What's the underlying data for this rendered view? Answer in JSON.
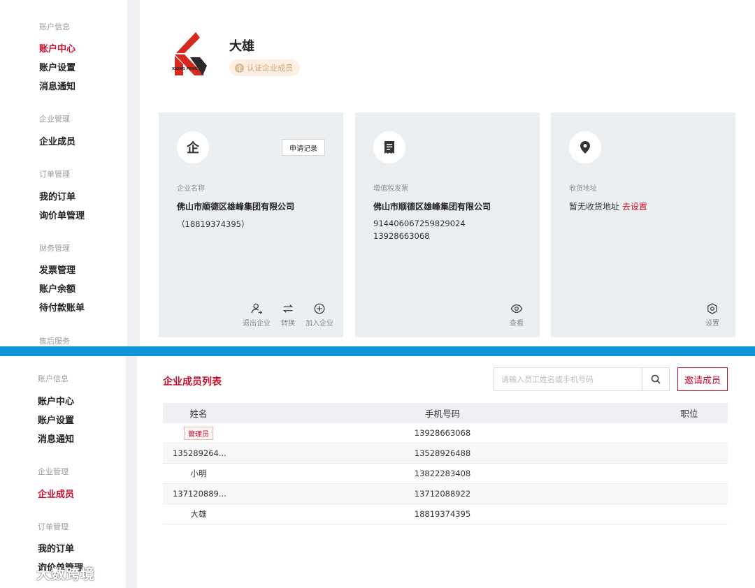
{
  "top_sidebar": {
    "sections": [
      {
        "title": "账户信息",
        "items": [
          "账户中心",
          "账户设置",
          "消息通知"
        ]
      },
      {
        "title": "企业管理",
        "items": [
          "企业成员"
        ]
      },
      {
        "title": "订单管理",
        "items": [
          "我的订单",
          "询价单管理"
        ]
      },
      {
        "title": "财务管理",
        "items": [
          "发票管理",
          "账户余额",
          "待付款账单"
        ]
      },
      {
        "title": "售后服务",
        "items": []
      }
    ],
    "active": "账户中心"
  },
  "header": {
    "logo_text": "XIONG FENG",
    "company_short": "大雄",
    "cert_badge": "认证企业成员",
    "cert_badge_icon": "企"
  },
  "cards": {
    "company": {
      "icon_char": "企",
      "apply_button": "申请记录",
      "label": "企业名称",
      "name": "佛山市顺德区雄峰集团有限公司",
      "phone": "（18819374395）",
      "actions": [
        "退出企业",
        "转换",
        "加入企业"
      ]
    },
    "invoice": {
      "label": "增值税发票",
      "name": "佛山市顺德区雄峰集团有限公司",
      "tax_id": "914406067259829024",
      "phone": "13928663068",
      "action": "查看"
    },
    "address": {
      "label": "收货地址",
      "empty_text": "暂无收货地址",
      "set_link": "去设置",
      "action": "设置"
    }
  },
  "bottom_sidebar": {
    "sections": [
      {
        "title": "账户信息",
        "items": [
          "账户中心",
          "账户设置",
          "消息通知"
        ]
      },
      {
        "title": "企业管理",
        "items": [
          "企业成员"
        ]
      },
      {
        "title": "订单管理",
        "items": [
          "我的订单",
          "询价单管理"
        ]
      }
    ],
    "active": "企业成员"
  },
  "members": {
    "title": "企业成员列表",
    "search_placeholder": "请输入员工姓名或手机号码",
    "invite_button": "邀请成员",
    "columns": [
      "姓名",
      "手机号码",
      "职位"
    ],
    "rows": [
      {
        "name": "管理员",
        "is_tag": true,
        "phone": "13928663068",
        "position": ""
      },
      {
        "name": "135289264...",
        "is_tag": false,
        "phone": "13528926488",
        "position": ""
      },
      {
        "name": "小明",
        "is_tag": false,
        "phone": "13822283408",
        "position": ""
      },
      {
        "name": "137120889...",
        "is_tag": false,
        "phone": "13712088922",
        "position": ""
      },
      {
        "name": "大雄",
        "is_tag": false,
        "phone": "18819374395",
        "position": ""
      }
    ]
  },
  "watermark": "大数跨境",
  "colors": {
    "accent": "#c8102e",
    "divider": "#0f95d6",
    "card_bg": "#eceff2",
    "badge_bg": "#fdf0e2"
  }
}
